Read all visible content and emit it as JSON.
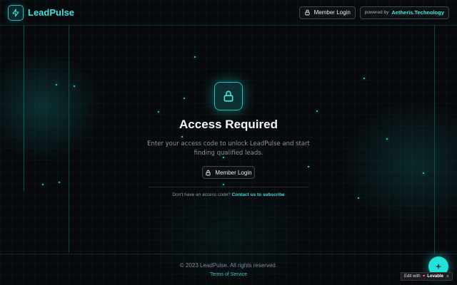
{
  "header": {
    "brand": "LeadPulse",
    "member_login": "Member Login",
    "powered_by": "powered by",
    "powered_company": "Aetheris.Technology"
  },
  "main": {
    "title": "Access Required",
    "subtitle_line1": "Enter your access code to unlock LeadPulse and start",
    "subtitle_line2": "finding qualified leads.",
    "member_login": "Member Login",
    "no_code_text": "Don't have an access code?",
    "contact_link": "Contact us to subscribe"
  },
  "footer": {
    "copyright": "© 2023 LeadPulse. All rights reserved.",
    "terms": "Terms of Service"
  },
  "badge": {
    "edit_with": "Edit with",
    "lovable": "Lovable",
    "close": "×"
  },
  "icons": {
    "logo": "pulse-icon",
    "lock": "lock-icon",
    "fab": "sparkle-icon"
  },
  "colors": {
    "accent": "#3fe3dc",
    "background": "#07090c",
    "text": "#f4f7f8",
    "muted": "#8995a0"
  }
}
